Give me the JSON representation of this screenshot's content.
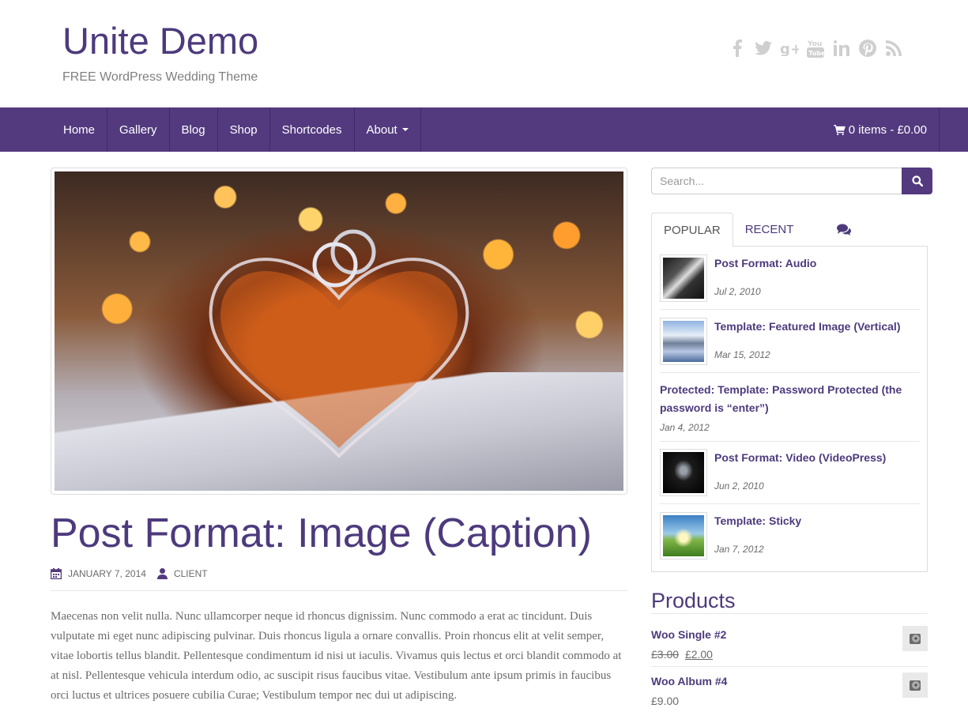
{
  "header": {
    "site_title": "Unite Demo",
    "site_description": "FREE WordPress Wedding Theme",
    "social": [
      "facebook-icon",
      "twitter-icon",
      "google-plus-icon",
      "youtube-icon",
      "linkedin-icon",
      "pinterest-icon",
      "rss-icon"
    ]
  },
  "colors": {
    "brand": "#533a7f",
    "link": "#4d3a7d",
    "text": "#6b6b6b"
  },
  "nav": {
    "items": [
      {
        "label": "Home"
      },
      {
        "label": "Gallery"
      },
      {
        "label": "Blog"
      },
      {
        "label": "Shop"
      },
      {
        "label": "Shortcodes"
      },
      {
        "label": "About"
      }
    ],
    "cart_label": "0 items - £0.00"
  },
  "post": {
    "title": "Post Format: Image (Caption)",
    "date": "JANUARY 7, 2014",
    "author": "CLIENT",
    "excerpt": "Maecenas non velit nulla. Nunc ullamcorper neque id rhoncus dignissim. Nunc commodo a erat ac tincidunt. Duis vulputate mi eget nunc adipiscing pulvinar. Duis rhoncus ligula a ornare convallis. Proin rhoncus elit at velit semper, vitae lobortis tellus blandit. Pellentesque condimentum id nisi ut iaculis. Vivamus quis lectus et orci blandit commodo at at nisl. Pellentesque vehicula interdum odio, ac suscipit risus faucibus vitae. Vestibulum ante ipsum primis in faucibus orci luctus et ultrices posuere cubilia Curae; Vestibulum tempor nec dui ut adipiscing."
  },
  "sidebar": {
    "search_placeholder": "Search...",
    "tabs": [
      {
        "label": "POPULAR"
      },
      {
        "label": "RECENT"
      },
      {
        "label": "comments-icon"
      }
    ],
    "popular": [
      {
        "title": "Post Format: Audio",
        "date": "Jul 2, 2010"
      },
      {
        "title": "Template: Featured Image (Vertical)",
        "date": "Mar 15, 2012"
      },
      {
        "title": "Protected: Template: Password Protected (the password is “enter”)",
        "date": "Jan 4, 2012"
      },
      {
        "title": "Post Format: Video (VideoPress)",
        "date": "Jun 2, 2010"
      },
      {
        "title": "Template: Sticky",
        "date": "Jan 7, 2012"
      }
    ],
    "products_title": "Products",
    "products": [
      {
        "name": "Woo Single #2",
        "old_price": "£3.00",
        "price": "£2.00"
      },
      {
        "name": "Woo Album #4",
        "price": "£9.00"
      }
    ]
  }
}
